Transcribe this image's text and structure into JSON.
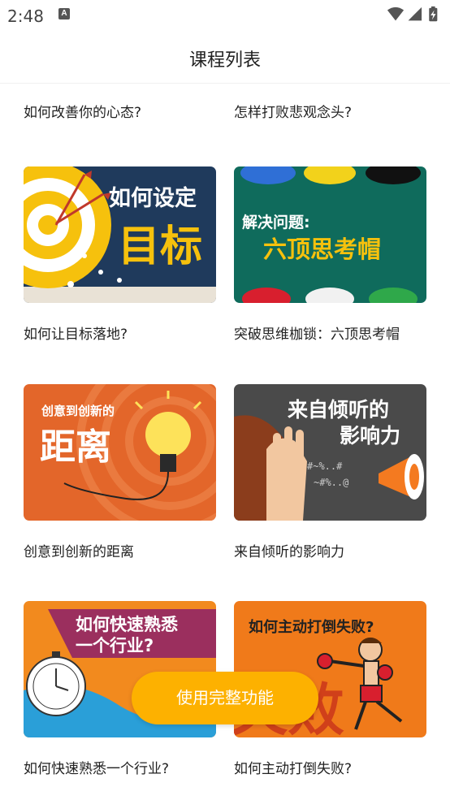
{
  "status_bar": {
    "time": "2:48",
    "notification_icon": "A"
  },
  "header": {
    "title": "课程列表"
  },
  "courses": [
    {
      "title": "如何改善你的心态?"
    },
    {
      "title": "怎样打败悲观念头?"
    },
    {
      "title": "如何让目标落地?",
      "thumb_text": [
        "如何设定",
        "目标"
      ]
    },
    {
      "title": "突破思维枷锁：六顶思考帽",
      "thumb_text": [
        "解决问题:",
        "六顶思考帽"
      ]
    },
    {
      "title": "创意到创新的距离",
      "thumb_text": [
        "创意到创新的",
        "距离"
      ]
    },
    {
      "title": "来自倾听的影响力",
      "thumb_text": [
        "来自倾听的",
        "影响力"
      ]
    },
    {
      "title": "如何快速熟悉一个行业?",
      "thumb_text": [
        "如何快速熟悉",
        "一个行业?"
      ]
    },
    {
      "title": "如何主动打倒失败?",
      "thumb_text": [
        "如何主动打倒失败?",
        "失败"
      ]
    }
  ],
  "cta": {
    "label": "使用完整功能",
    "color": "#fdb100"
  }
}
